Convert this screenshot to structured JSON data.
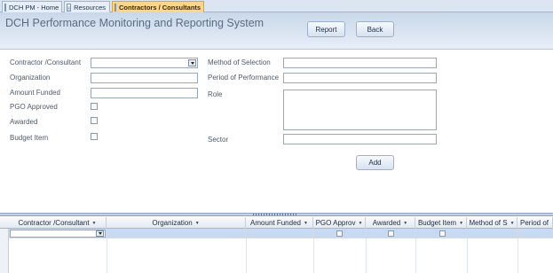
{
  "tabs": [
    {
      "label": "DCH PM - Home"
    },
    {
      "label": "Resources"
    },
    {
      "label": "Contractors / Consultants",
      "active": true
    }
  ],
  "header": {
    "title": "DCH Performance Monitoring and Reporting System",
    "report_label": "Report",
    "back_label": "Back"
  },
  "form": {
    "contractor_label": "Contractor /Consultant",
    "organization_label": "Organization",
    "amount_funded_label": "Amount Funded",
    "pgo_approved_label": "PGO Approved",
    "awarded_label": "Awarded",
    "budget_item_label": "Budget Item",
    "method_label": "Method of Selection",
    "period_label": "Period of Performance",
    "role_label": "Role",
    "sector_label": "Sector",
    "add_label": "Add"
  },
  "grid": {
    "columns": [
      "Contractor /Consultant",
      "Organization",
      "Amount Funded",
      "PGO Approv",
      "Awarded",
      "Budget Item",
      "Method of S",
      "Period of"
    ]
  },
  "colors": {
    "active_tab": "#fbd58a",
    "header_bg": "#c9d8ea",
    "selected_row": "#c8daf2"
  }
}
